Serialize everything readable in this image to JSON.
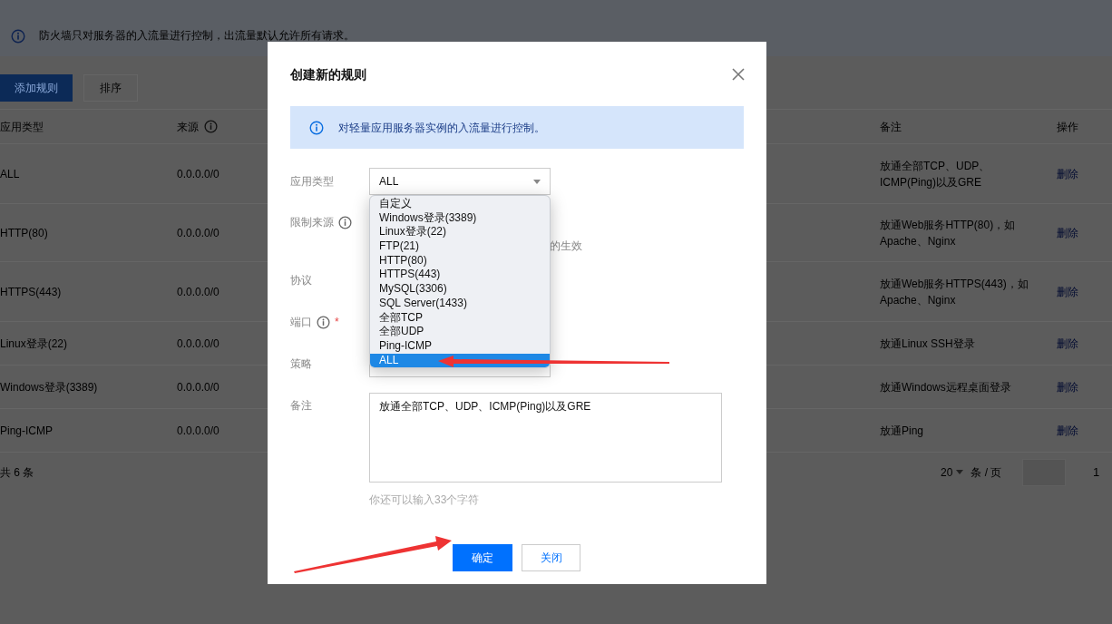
{
  "page": {
    "notice": "防火墙只对服务器的入流量进行控制，出流量默认允许所有请求。",
    "buttons": [
      {
        "label": "添加规则",
        "kind": "primary"
      },
      {
        "label": "排序",
        "kind": "default"
      }
    ],
    "table": {
      "columns": [
        {
          "label": "应用类型",
          "has_info": false
        },
        {
          "label": "来源",
          "has_info": true
        },
        {
          "label": "备注",
          "has_info": false
        },
        {
          "label": "操作",
          "has_info": false
        }
      ],
      "rows": [
        {
          "type": "ALL",
          "source": "0.0.0.0/0",
          "note": "放通全部TCP、UDP、ICMP(Ping)以及GRE",
          "action": "删除"
        },
        {
          "type": "HTTP(80)",
          "source": "0.0.0.0/0",
          "note": "放通Web服务HTTP(80)，如Apache、Nginx",
          "action": "删除"
        },
        {
          "type": "HTTPS(443)",
          "source": "0.0.0.0/0",
          "note": "放通Web服务HTTPS(443)，如Apache、Nginx",
          "action": "删除"
        },
        {
          "type": "Linux登录(22)",
          "source": "0.0.0.0/0",
          "note": "放通Linux SSH登录",
          "action": "删除"
        },
        {
          "type": "Windows登录(3389)",
          "source": "0.0.0.0/0",
          "note": "放通Windows远程桌面登录",
          "action": "删除"
        },
        {
          "type": "Ping-ICMP",
          "source": "0.0.0.0/0",
          "note": "放通Ping",
          "action": "删除"
        }
      ],
      "footer": {
        "total": "共 6 条",
        "page_size": "20",
        "per_page": "条 / 页",
        "page": "1"
      }
    }
  },
  "dialog": {
    "title": "创建新的规则",
    "notice": "对轻量应用服务器实例的入流量进行控制。",
    "fields": [
      {
        "label": "应用类型",
        "has_info": false,
        "required": false,
        "kind": "select",
        "value": "ALL"
      },
      {
        "label": "限制来源",
        "has_info": true,
        "required": false,
        "kind": "covered",
        "hint": "的生效"
      },
      {
        "label": "协议",
        "has_info": false,
        "required": false,
        "kind": "covered"
      },
      {
        "label": "端口",
        "has_info": true,
        "required": true,
        "required_mark": "*",
        "kind": "covered"
      },
      {
        "label": "策略",
        "has_info": false,
        "required": false,
        "kind": "covered_select"
      },
      {
        "label": "备注",
        "has_info": false,
        "required": false,
        "kind": "textarea",
        "value": "放通全部TCP、UDP、ICMP(Ping)以及GRE",
        "hint": "你还可以输入33个字符"
      }
    ],
    "dropdown": [
      {
        "label": "自定义",
        "selected": false
      },
      {
        "label": "Windows登录(3389)",
        "selected": false
      },
      {
        "label": "Linux登录(22)",
        "selected": false
      },
      {
        "label": "FTP(21)",
        "selected": false
      },
      {
        "label": "HTTP(80)",
        "selected": false
      },
      {
        "label": "HTTPS(443)",
        "selected": false
      },
      {
        "label": "MySQL(3306)",
        "selected": false
      },
      {
        "label": "SQL Server(1433)",
        "selected": false
      },
      {
        "label": "全部TCP",
        "selected": false
      },
      {
        "label": "全部UDP",
        "selected": false
      },
      {
        "label": "Ping-ICMP",
        "selected": false
      },
      {
        "label": "ALL",
        "selected": true
      }
    ],
    "buttons": [
      {
        "label": "确定",
        "kind": "primary"
      },
      {
        "label": "关闭",
        "kind": "default"
      }
    ]
  }
}
